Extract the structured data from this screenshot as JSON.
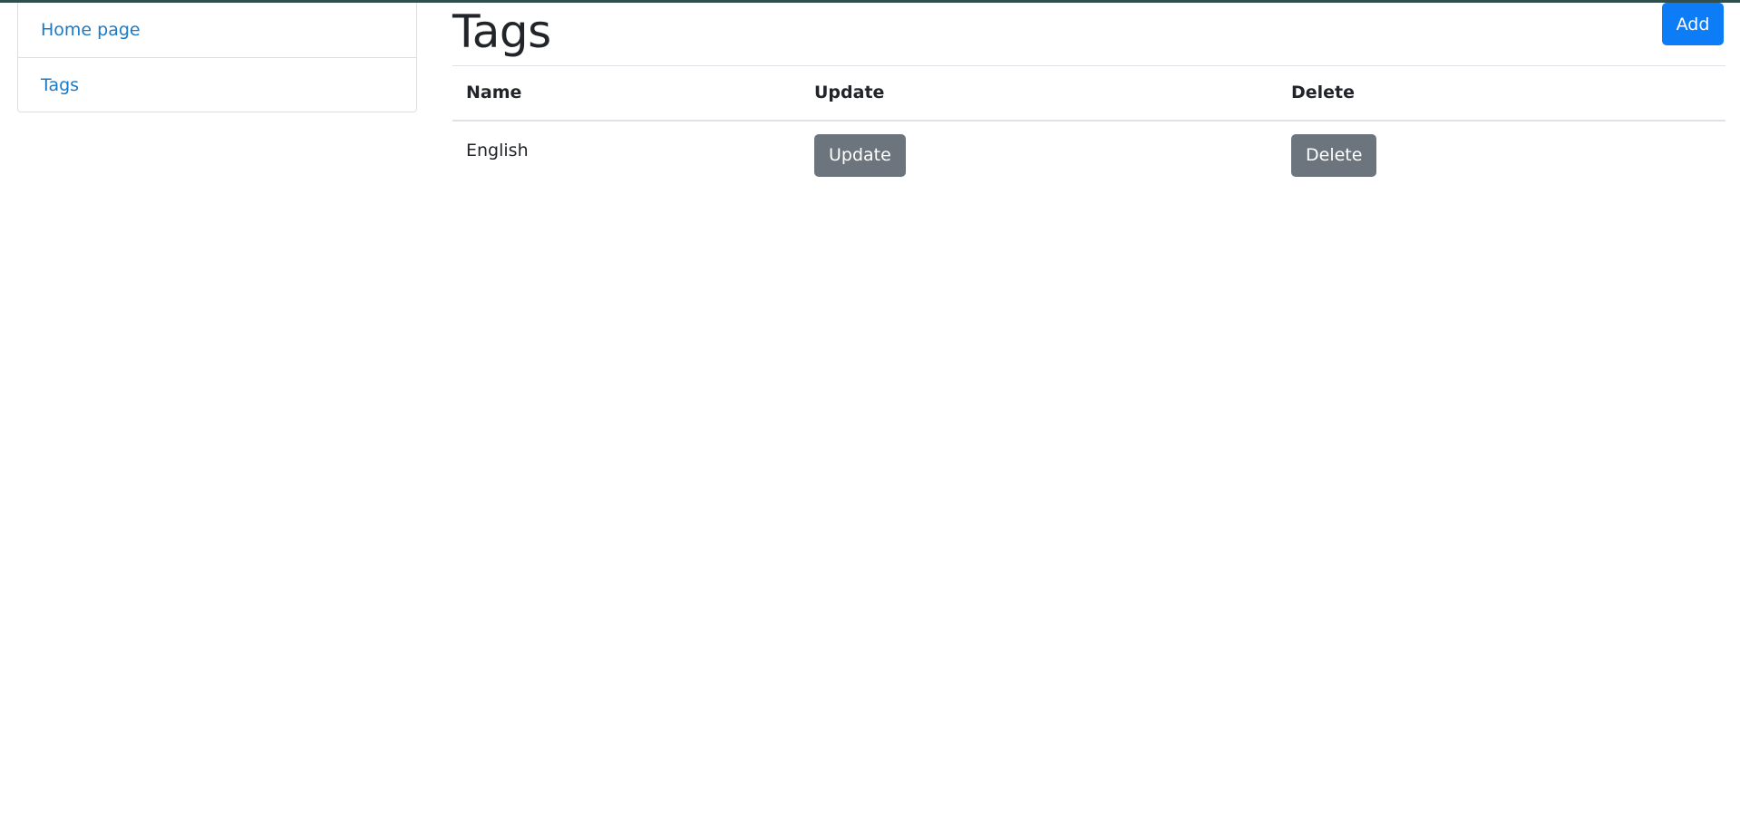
{
  "sidebar": {
    "items": [
      {
        "label": "Home page"
      },
      {
        "label": "Tags"
      }
    ]
  },
  "main": {
    "title": "Tags",
    "add_label": "Add",
    "table": {
      "headers": [
        "Name",
        "Update",
        "Delete"
      ],
      "rows": [
        {
          "name": "English",
          "update_label": "Update",
          "delete_label": "Delete"
        }
      ]
    }
  },
  "colors": {
    "link": "#1b7ac6",
    "primary": "#0d7cf7",
    "secondary": "#6c757d"
  }
}
